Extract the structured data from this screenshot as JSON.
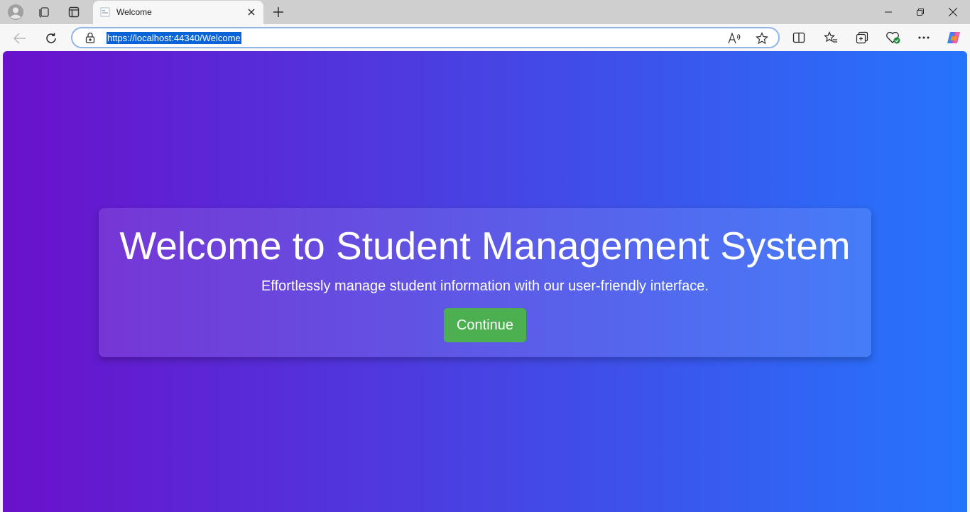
{
  "browser": {
    "tab": {
      "title": "Welcome"
    },
    "address": {
      "url": "https://localhost:44340/Welcome"
    },
    "icons": {
      "profile": "profile-icon",
      "workspaces": "workspaces-icon",
      "vertical_tabs": "tab-actions-icon",
      "favicon": "page-favicon",
      "close": "close-icon",
      "new_tab": "plus-icon",
      "minimize": "minimize-icon",
      "restore": "restore-icon",
      "close_window": "close-icon",
      "back": "back-arrow-icon",
      "refresh": "refresh-icon",
      "lock": "lock-icon",
      "read_aloud": "read-aloud-icon",
      "favorite": "star-icon",
      "split": "split-screen-icon",
      "favorites": "favorites-icon",
      "collections": "collections-icon",
      "health": "browser-essentials-icon",
      "more": "more-icon",
      "copilot": "copilot-icon"
    }
  },
  "page": {
    "background_gradient": [
      "#6a11cb",
      "#2575fc"
    ],
    "heading": "Welcome to Student Management System",
    "subtitle": "Effortlessly manage student information with our user-friendly interface.",
    "continue_label": "Continue",
    "button_color": "#4caf50"
  }
}
